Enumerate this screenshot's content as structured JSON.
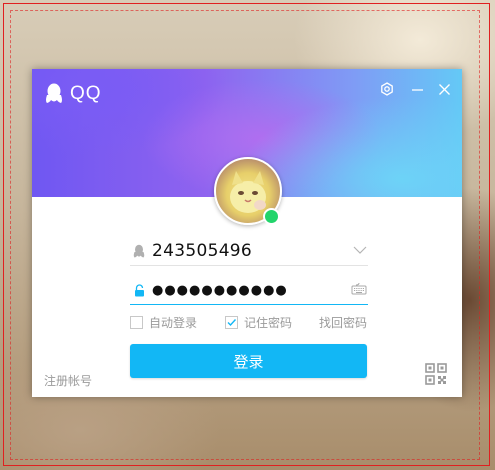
{
  "app": {
    "name": "QQ"
  },
  "login": {
    "account": "243505496",
    "password_mask": "●●●●●●●●●●●",
    "auto_login_label": "自动登录",
    "auto_login_checked": false,
    "remember_password_label": "记住密码",
    "remember_password_checked": true,
    "forgot_password_label": "找回密码",
    "login_button_label": "登录",
    "register_label": "注册帐号"
  },
  "icons": {
    "logo": "qq-penguin-icon",
    "settings": "gear-icon",
    "minimize": "minimize-icon",
    "close": "close-icon",
    "account_field": "penguin-silhouette-icon",
    "dropdown": "chevron-down-icon",
    "password_field": "lock-icon",
    "keyboard": "keyboard-icon",
    "qr": "qr-code-icon"
  },
  "colors": {
    "accent": "#12b7f5",
    "status_online": "#22d46b",
    "frame_border": "#e02020"
  }
}
